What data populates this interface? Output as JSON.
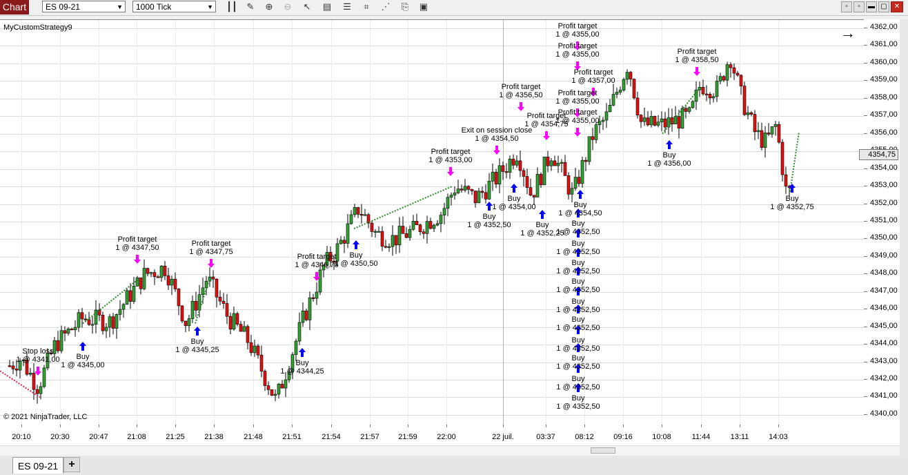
{
  "toolbar": {
    "tab_label": "Chart",
    "instrument": "ES 09-21",
    "interval": "1000 Tick",
    "icons": [
      "bar-type-icon",
      "draw-pencil-icon",
      "zoom-in-icon",
      "zoom-out-icon",
      "pointer-icon",
      "data-box-icon",
      "properties-icon",
      "strategy-icon",
      "indicators-icon",
      "templates-icon"
    ]
  },
  "chart": {
    "strategy_name": "MyCustomStrategy9",
    "copyright": "© 2021 NinjaTrader, LLC",
    "current_price": "4354,75",
    "y_ticks": [
      "4362,00",
      "4361,00",
      "4360,00",
      "4359,00",
      "4358,00",
      "4357,00",
      "4356,00",
      "4355,00",
      "4354,00",
      "4353,00",
      "4352,00",
      "4351,00",
      "4350,00",
      "4349,00",
      "4348,00",
      "4347,00",
      "4346,00",
      "4345,00",
      "4344,00",
      "4343,00",
      "4342,00",
      "4341,00",
      "4340,00"
    ],
    "x_ticks": [
      "20:10",
      "20:30",
      "20:47",
      "21:08",
      "21:25",
      "21:38",
      "21:48",
      "21:51",
      "21:54",
      "21:57",
      "21:59",
      "22:00",
      "22 juil.",
      "03:37",
      "08:12",
      "09:16",
      "10:08",
      "11:44",
      "13:11",
      "14:03"
    ]
  },
  "annotations": [
    {
      "title": "Stop loss",
      "detail": "1 @ 4341,00"
    },
    {
      "title": "Buy",
      "detail": "1 @ 4345,00"
    },
    {
      "title": "Profit target",
      "detail": "1 @ 4347,50"
    },
    {
      "title": "Profit target",
      "detail": "1 @ 4347,75"
    },
    {
      "title": "Buy",
      "detail": "1 @ 4345,25"
    },
    {
      "title": "Buy",
      "detail": "1 @ 4344,25"
    },
    {
      "title": "Profit target",
      "detail": "1 @ 4346,75"
    },
    {
      "title": "Buy",
      "detail": "1 @ 4350,50"
    },
    {
      "title": "Profit target",
      "detail": "1 @ 4353,00"
    },
    {
      "title": "Buy",
      "detail": "1 @ 4352,50"
    },
    {
      "title": "Exit on session close",
      "detail": "1 @ 4354,50"
    },
    {
      "title": "Profit target",
      "detail": "1 @ 4356,50"
    },
    {
      "title": "Buy",
      "detail": "1 @ 4354,00"
    },
    {
      "title": "Profit target",
      "detail": "1 @ 4354,75"
    },
    {
      "title": "Buy",
      "detail": "1 @ 4352,25"
    },
    {
      "title": "Profit target",
      "detail": "1 @ 4355,00"
    },
    {
      "title": "Profit target",
      "detail": "1 @ 4355,00"
    },
    {
      "title": "Profit target",
      "detail": "1 @ 4357,00"
    },
    {
      "title": "Profit target",
      "detail": "1 @ 4355,00"
    },
    {
      "title": "Profit target",
      "detail": "1 @ 4355,00"
    },
    {
      "title": "Buy",
      "detail": "1 @ 4354,50"
    },
    {
      "title": "Buy",
      "detail": "1 @ 4352,50"
    },
    {
      "title": "Buy",
      "detail": "1 @ 4352,50"
    },
    {
      "title": "Buy",
      "detail": "1 @ 4352,50"
    },
    {
      "title": "Buy",
      "detail": "1 @ 4352,50"
    },
    {
      "title": "Buy",
      "detail": "1 @ 4352,50"
    },
    {
      "title": "Buy",
      "detail": "1 @ 4352,50"
    },
    {
      "title": "Buy",
      "detail": "1 @ 4352,50"
    },
    {
      "title": "Buy",
      "detail": "1 @ 4352,50"
    },
    {
      "title": "Buy",
      "detail": "1 @ 4352,50"
    },
    {
      "title": "Buy",
      "detail": "1 @ 4352,50"
    },
    {
      "title": "Profit target",
      "detail": "1 @ 4358,50"
    },
    {
      "title": "Buy",
      "detail": "1 @ 4356,00"
    },
    {
      "title": "Buy",
      "detail": "1 @ 4352,75"
    }
  ],
  "tabs": {
    "instrument_tab": "ES 09-21",
    "add_tab": "+"
  },
  "colors": {
    "up_candle": "#32a032",
    "down_candle": "#e01010",
    "buy_marker": "#0000ff",
    "exit_marker": "#ff00ff",
    "chart_tab_bg": "#8b1a1a"
  }
}
